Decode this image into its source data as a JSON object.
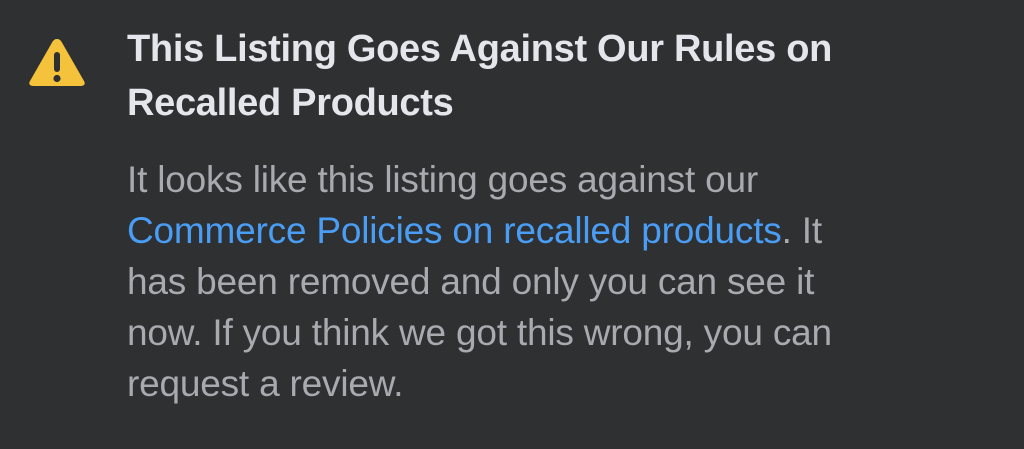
{
  "notice": {
    "icon": "warning-triangle-icon",
    "icon_color": "#f5c33b",
    "title_line1": "This Listing Goes Against Our Rules on",
    "title_line2": "Recalled Products",
    "body": {
      "line1": "It looks like this listing goes against our",
      "link_text": "Commerce Policies on recalled products",
      "line2_after_link": ". It",
      "line3": "has been removed and only you can see it",
      "line4": "now. If you think we got this wrong, you can",
      "line5": "request a review."
    },
    "colors": {
      "background": "#2f3032",
      "title": "#e4e6eb",
      "body": "#a8aab0",
      "link": "#4a9df4"
    }
  }
}
